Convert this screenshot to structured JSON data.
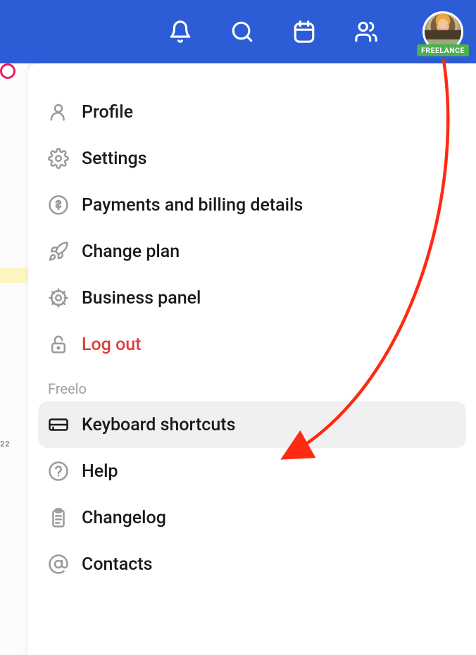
{
  "topbar": {
    "badge": "FREELANCE"
  },
  "menu": {
    "profile": "Profile",
    "settings": "Settings",
    "payments": "Payments and billing details",
    "change_plan": "Change plan",
    "business_panel": "Business panel",
    "logout": "Log out"
  },
  "section_label": "Freelo",
  "submenu": {
    "keyboard": "Keyboard shortcuts",
    "help": "Help",
    "changelog": "Changelog",
    "contacts": "Contacts"
  },
  "colors": {
    "topbar": "#2d5dd6",
    "badge": "#4caf50",
    "danger": "#e03b3b",
    "arrow": "#ff2a12"
  }
}
